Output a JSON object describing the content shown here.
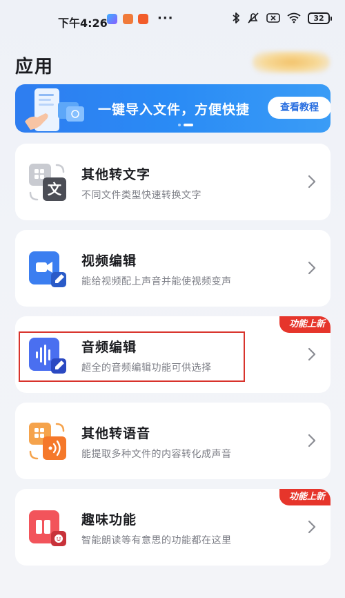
{
  "status_bar": {
    "time": "下午4:26",
    "more": "···",
    "battery": "32",
    "app_icons": [
      "play-store-icon",
      "orange-app-icon",
      "mi-app-icon"
    ]
  },
  "header": {
    "title": "应用"
  },
  "banner": {
    "text": "一键导入文件，方便快捷",
    "button": "查看教程",
    "page_count": 2,
    "active_page": 2
  },
  "cards": [
    {
      "title": "其他转文字",
      "desc": "不同文件类型快速转换文字",
      "icon": "text-convert-icon",
      "new": false
    },
    {
      "title": "视频编辑",
      "desc": "能给视频配上声音并能使视频变声",
      "icon": "video-edit-icon",
      "new": false
    },
    {
      "title": "音频编辑",
      "desc": "超全的音频编辑功能可供选择",
      "icon": "audio-edit-icon",
      "new": true,
      "tag": "功能上新"
    },
    {
      "title": "其他转语音",
      "desc": "能提取多种文件的内容转化成声音",
      "icon": "voice-convert-icon",
      "new": false
    },
    {
      "title": "趣味功能",
      "desc": "智能朗读等有意思的功能都在这里",
      "icon": "fun-feature-icon",
      "new": true,
      "tag": "功能上新"
    }
  ],
  "colors": {
    "accent_blue": "#2a8bf5",
    "new_tag_red": "#e6352b",
    "highlight_red": "#d8332c",
    "orange": "#f5782a"
  }
}
